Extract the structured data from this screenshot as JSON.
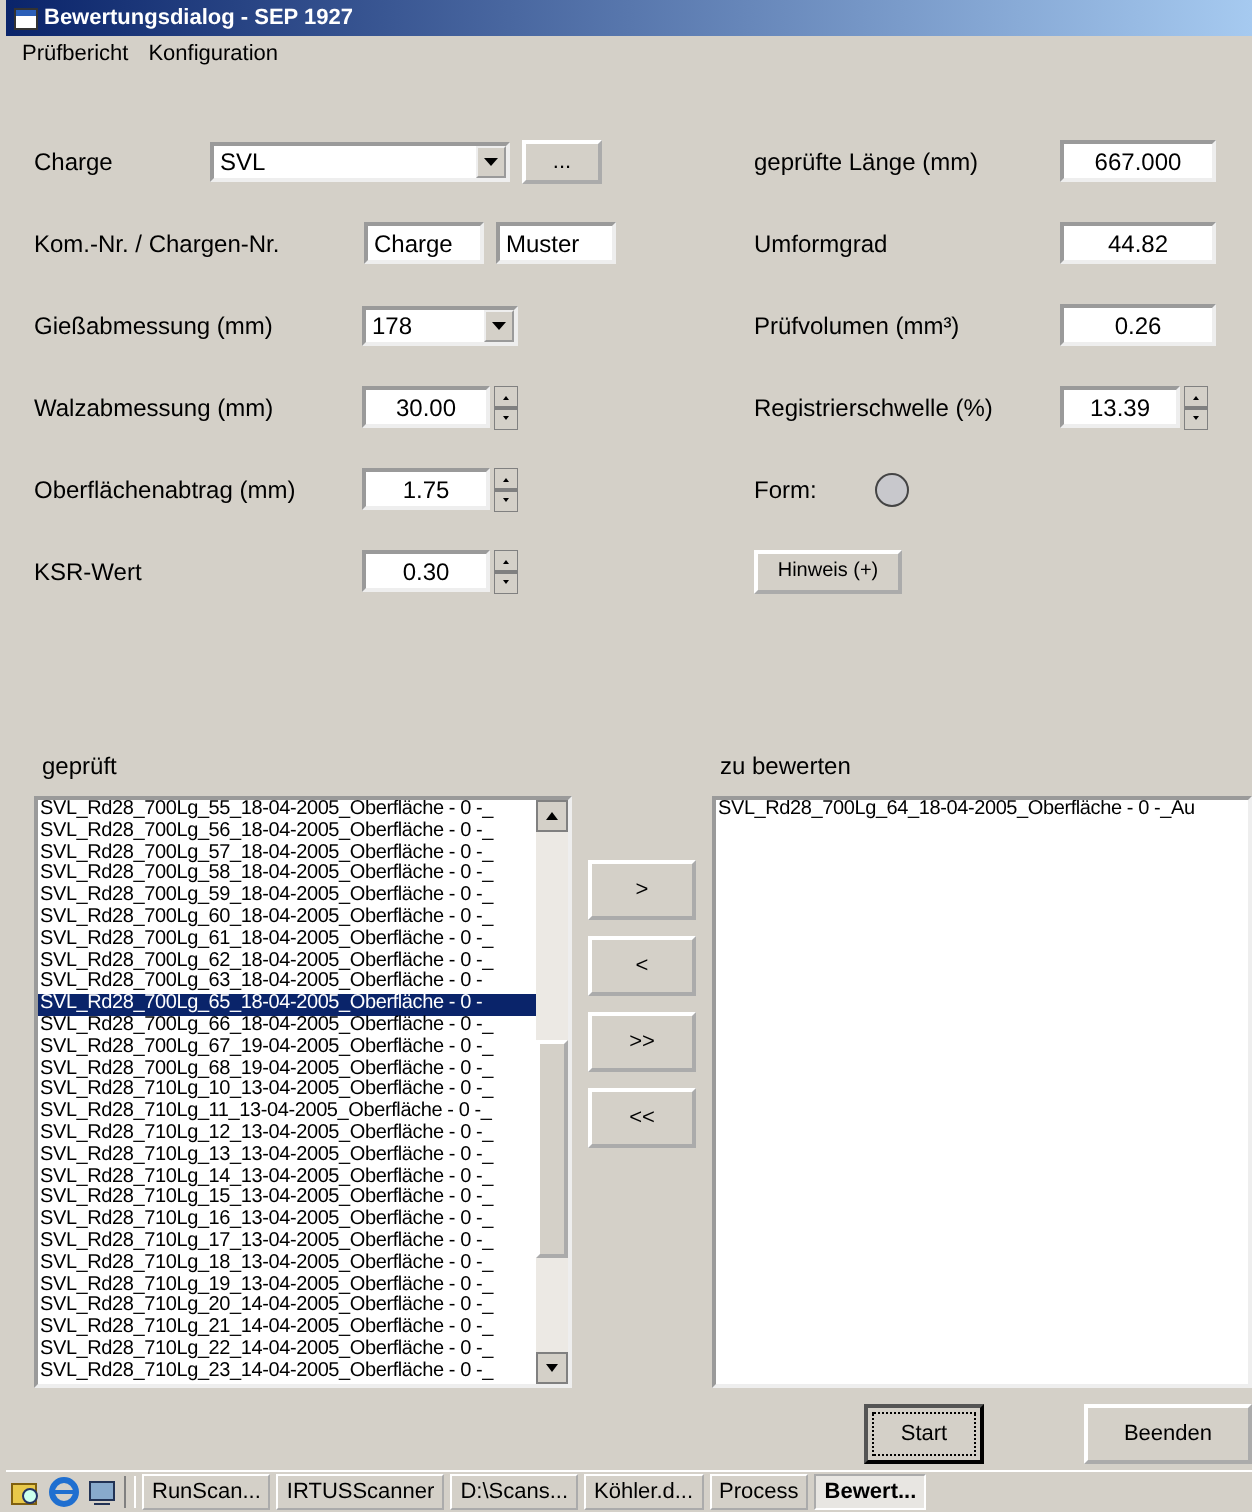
{
  "window": {
    "title": "Bewertungsdialog - SEP 1927"
  },
  "menu": [
    "Prüfbericht",
    "Konfiguration"
  ],
  "left_fields": [
    {
      "kind": "combo_button",
      "label": "Charge",
      "value": "SVL",
      "button": "..."
    },
    {
      "kind": "text_pair",
      "label": "Kom.-Nr. / Chargen-Nr.",
      "values": [
        "Charge",
        "Muster"
      ]
    },
    {
      "kind": "combo",
      "label": "Gießabmessung (mm)",
      "value": "178"
    },
    {
      "kind": "spinner",
      "label": "Walzabmessung (mm)",
      "value": "30.00"
    },
    {
      "kind": "spinner",
      "label": "Oberflächenabtrag (mm)",
      "value": "1.75"
    },
    {
      "kind": "spinner",
      "label": "KSR-Wert",
      "value": "0.30"
    }
  ],
  "right_fields": [
    {
      "kind": "field",
      "label": "geprüfte Länge (mm)",
      "value": "667.000"
    },
    {
      "kind": "field",
      "label": "Umformgrad",
      "value": "44.82"
    },
    {
      "kind": "field",
      "label": "Prüfvolumen (mm³)",
      "value": "0.26"
    },
    {
      "kind": "spinner",
      "label": "Registrierschwelle (%)",
      "value": "13.39"
    },
    {
      "kind": "shape",
      "label": "Form:"
    },
    {
      "kind": "button",
      "label": "Hinweis (+)"
    }
  ],
  "checked_list": {
    "label": "geprüft",
    "items": [
      {
        "text": "SVL_Rd28_700Lg_55_18-04-2005_Oberfläche - 0 -_",
        "selected": false
      },
      {
        "text": "SVL_Rd28_700Lg_56_18-04-2005_Oberfläche - 0 -_",
        "selected": false
      },
      {
        "text": "SVL_Rd28_700Lg_57_18-04-2005_Oberfläche - 0 -_",
        "selected": false
      },
      {
        "text": "SVL_Rd28_700Lg_58_18-04-2005_Oberfläche - 0 -_",
        "selected": false
      },
      {
        "text": "SVL_Rd28_700Lg_59_18-04-2005_Oberfläche - 0 -_",
        "selected": false
      },
      {
        "text": "SVL_Rd28_700Lg_60_18-04-2005_Oberfläche - 0 -_",
        "selected": false
      },
      {
        "text": "SVL_Rd28_700Lg_61_18-04-2005_Oberfläche - 0 -_",
        "selected": false
      },
      {
        "text": "SVL_Rd28_700Lg_62_18-04-2005_Oberfläche - 0 -_",
        "selected": false
      },
      {
        "text": "SVL_Rd28_700Lg_63_18-04-2005_Oberfläche - 0 -",
        "selected": false
      },
      {
        "text": "SVL_Rd28_700Lg_65_18-04-2005_Oberfläche - 0 -",
        "selected": true
      },
      {
        "text": "SVL_Rd28_700Lg_66_18-04-2005_Oberfläche - 0 -_",
        "selected": false
      },
      {
        "text": "SVL_Rd28_700Lg_67_19-04-2005_Oberfläche - 0 -_",
        "selected": false
      },
      {
        "text": "SVL_Rd28_700Lg_68_19-04-2005_Oberfläche - 0 -_",
        "selected": false
      },
      {
        "text": "SVL_Rd28_710Lg_10_13-04-2005_Oberfläche - 0 -_",
        "selected": false
      },
      {
        "text": "SVL_Rd28_710Lg_11_13-04-2005_Oberfläche - 0 -_",
        "selected": false
      },
      {
        "text": "SVL_Rd28_710Lg_12_13-04-2005_Oberfläche - 0 -_",
        "selected": false
      },
      {
        "text": "SVL_Rd28_710Lg_13_13-04-2005_Oberfläche - 0 -_",
        "selected": false
      },
      {
        "text": "SVL_Rd28_710Lg_14_13-04-2005_Oberfläche - 0 -_",
        "selected": false
      },
      {
        "text": "SVL_Rd28_710Lg_15_13-04-2005_Oberfläche - 0 -_",
        "selected": false
      },
      {
        "text": "SVL_Rd28_710Lg_16_13-04-2005_Oberfläche - 0 -_",
        "selected": false
      },
      {
        "text": "SVL_Rd28_710Lg_17_13-04-2005_Oberfläche - 0 -_",
        "selected": false
      },
      {
        "text": "SVL_Rd28_710Lg_18_13-04-2005_Oberfläche - 0 -_",
        "selected": false
      },
      {
        "text": "SVL_Rd28_710Lg_19_13-04-2005_Oberfläche - 0 -_",
        "selected": false
      },
      {
        "text": "SVL_Rd28_710Lg_20_14-04-2005_Oberfläche - 0 -_",
        "selected": false
      },
      {
        "text": "SVL_Rd28_710Lg_21_14-04-2005_Oberfläche - 0 -_",
        "selected": false
      },
      {
        "text": "SVL_Rd28_710Lg_22_14-04-2005_Oberfläche - 0 -_",
        "selected": false
      },
      {
        "text": "SVL_Rd28_710Lg_23_14-04-2005_Oberfläche - 0 -_",
        "selected": false
      }
    ]
  },
  "move_buttons": [
    ">",
    "<",
    ">>",
    "<<"
  ],
  "pending_list": {
    "label": "zu bewerten",
    "items": [
      {
        "text": "SVL_Rd28_700Lg_64_18-04-2005_Oberfläche - 0 -_Au",
        "selected": false
      }
    ]
  },
  "buttons": [
    "Start",
    "Beenden"
  ],
  "taskbar": {
    "tasks": [
      {
        "label": "RunScan...",
        "selected": false
      },
      {
        "label": "IRTUSScanner",
        "selected": false
      },
      {
        "label": "D:\\Scans...",
        "selected": false
      },
      {
        "label": "Köhler.d...",
        "selected": false
      },
      {
        "label": "Process",
        "selected": false
      },
      {
        "label": "Bewert...",
        "selected": true
      }
    ]
  }
}
